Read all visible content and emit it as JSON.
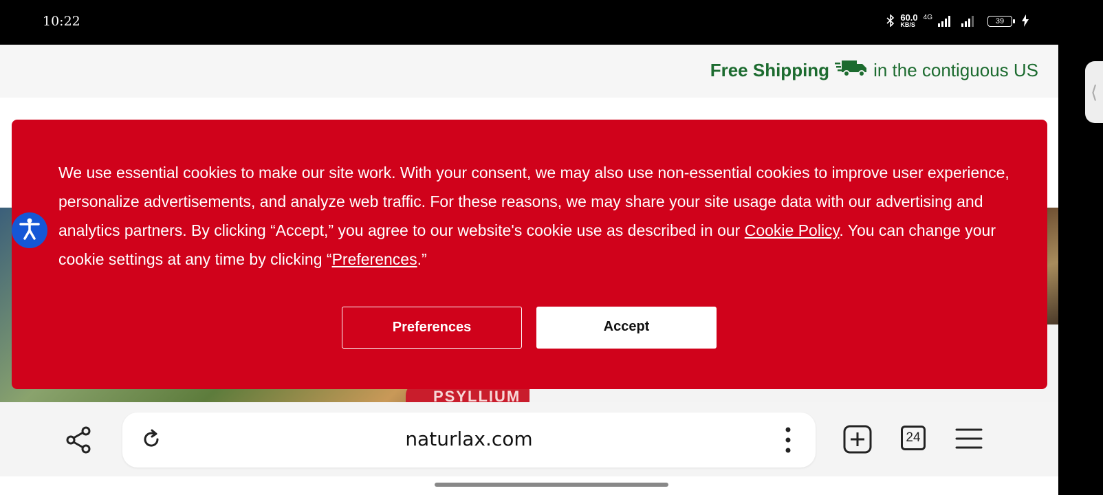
{
  "status_bar": {
    "time": "10:22",
    "network_speed": "60.0",
    "network_speed_unit": "KB/S",
    "network_type": "4G",
    "battery_level": "39"
  },
  "banner": {
    "shipping_bold": "Free Shipping",
    "shipping_rest": "in the contiguous US",
    "shipping_icon": "delivery-truck-icon"
  },
  "cookie": {
    "text_part1": "We use essential cookies to make our site work. With your consent, we may also use non-essential cookies to improve user experience, personalize advertisements, and analyze web traffic. For these reasons, we may share your site usage data with our advertising and analytics partners. By clicking “Accept,” you agree to our website's cookie use as described in our ",
    "policy_link": "Cookie Policy",
    "text_part2": ". You can change your cookie settings at any time by clicking “",
    "preferences_link": "Preferences",
    "text_part3": ".”",
    "preferences_button": "Preferences",
    "accept_button": "Accept",
    "color": "#d0021b"
  },
  "background": {
    "product_label": "PSYLLIUM"
  },
  "browser": {
    "url": "naturlax.com",
    "tab_count": "24"
  },
  "colors": {
    "shipping_green": "#1c6b2f",
    "a11y_blue": "#1557d6"
  }
}
